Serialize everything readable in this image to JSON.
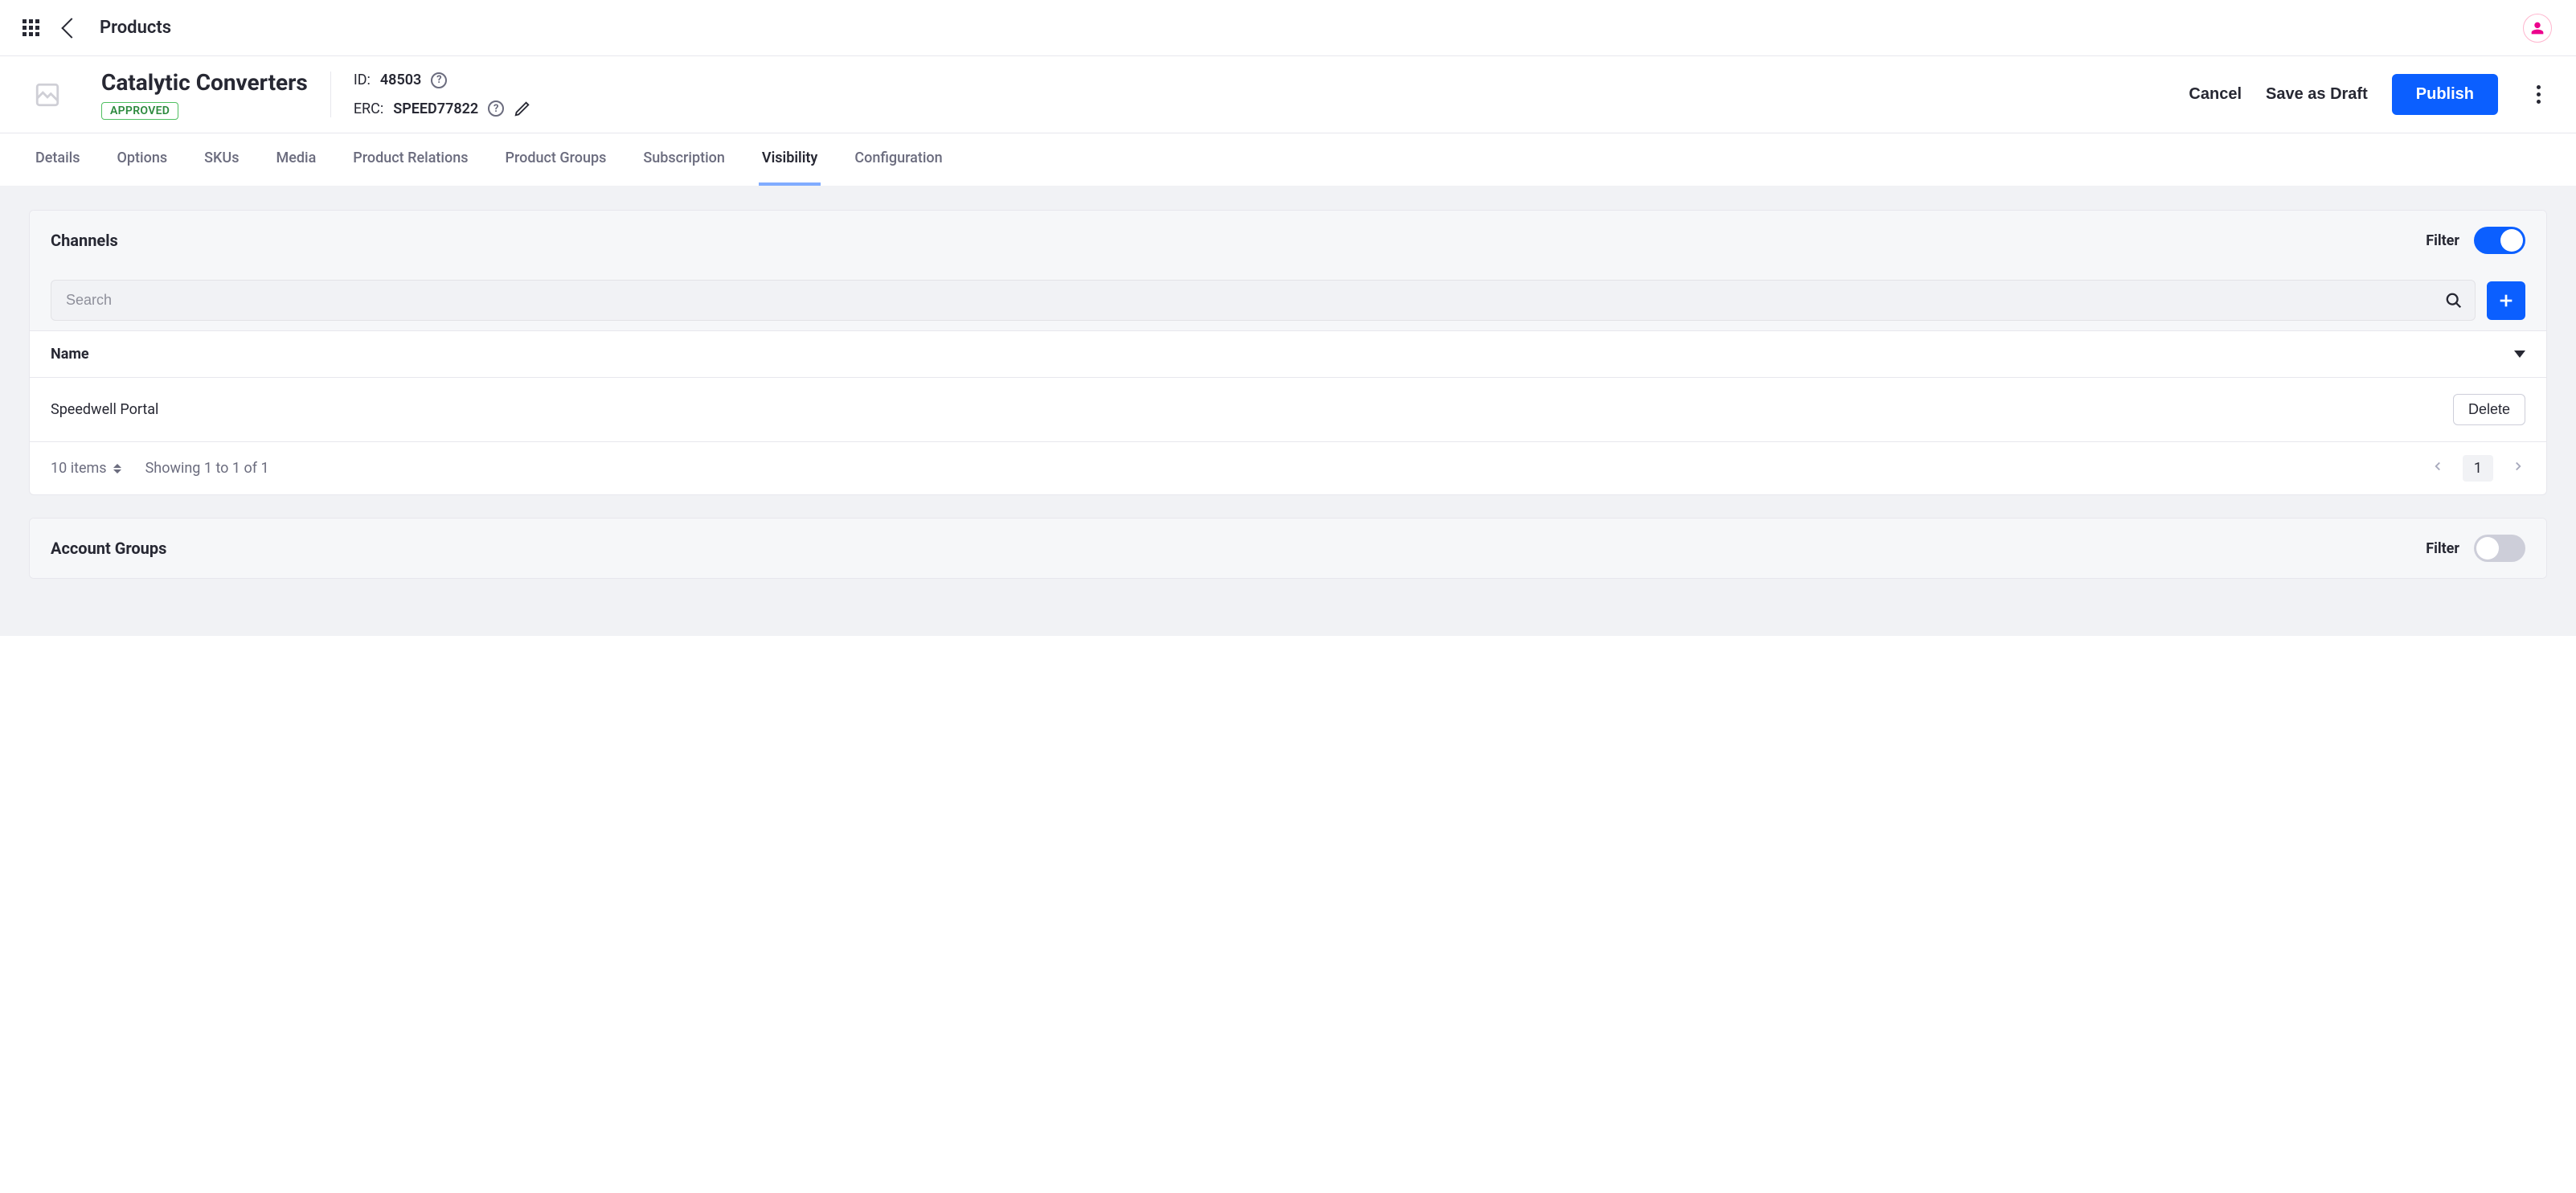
{
  "topbar": {
    "breadcrumb": "Products"
  },
  "header": {
    "title": "Catalytic Converters",
    "status": "APPROVED",
    "id_label": "ID:",
    "id_value": "48503",
    "erc_label": "ERC:",
    "erc_value": "SPEED77822",
    "actions": {
      "cancel": "Cancel",
      "draft": "Save as Draft",
      "publish": "Publish"
    }
  },
  "tabs": [
    {
      "label": "Details",
      "active": false
    },
    {
      "label": "Options",
      "active": false
    },
    {
      "label": "SKUs",
      "active": false
    },
    {
      "label": "Media",
      "active": false
    },
    {
      "label": "Product Relations",
      "active": false
    },
    {
      "label": "Product Groups",
      "active": false
    },
    {
      "label": "Subscription",
      "active": false
    },
    {
      "label": "Visibility",
      "active": true
    },
    {
      "label": "Configuration",
      "active": false
    }
  ],
  "channels": {
    "title": "Channels",
    "filter_label": "Filter",
    "filter_on": true,
    "search_placeholder": "Search",
    "column_header": "Name",
    "rows": [
      {
        "name": "Speedwell Portal",
        "action": "Delete"
      }
    ],
    "items_select": "10 items",
    "showing_text": "Showing 1 to 1 of 1",
    "current_page": "1"
  },
  "account_groups": {
    "title": "Account Groups",
    "filter_label": "Filter",
    "filter_on": false
  }
}
